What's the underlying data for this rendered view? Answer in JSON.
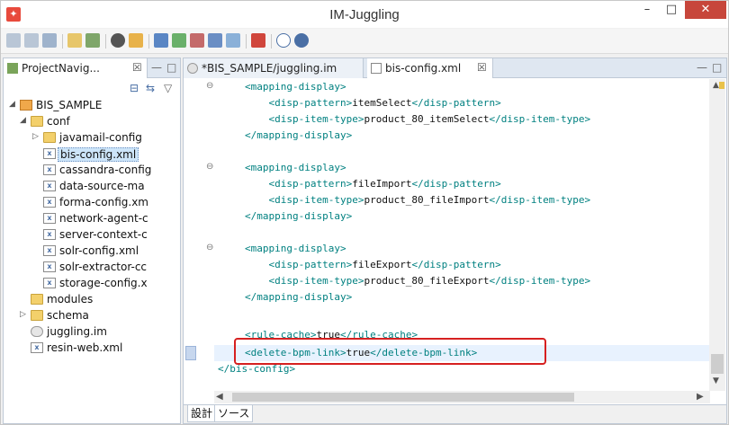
{
  "window": {
    "title": "IM-Juggling",
    "app_icon_glyph": "✦",
    "min_glyph": "–",
    "max_glyph": "□",
    "close_glyph": "✕"
  },
  "left_panel": {
    "tab_label": "ProjectNavig...",
    "tab_close": "☒",
    "ctl_min": "—",
    "ctl_max": "□",
    "collapse_glyph": "⊟",
    "link_glyph": "⇆",
    "menu_glyph": "▽",
    "tree": [
      {
        "label": "BIS_SAMPLE",
        "icon": "project-icon",
        "expanded": true
      },
      {
        "label": "conf",
        "icon": "folder-icon",
        "expanded": true
      },
      {
        "label": "javamail-config",
        "icon": "folder-icon",
        "expanded": false
      },
      {
        "label": "bis-config.xml",
        "icon": "xml-file-icon"
      },
      {
        "label": "cassandra-config",
        "icon": "xml-file-icon"
      },
      {
        "label": "data-source-ma",
        "icon": "xml-file-icon"
      },
      {
        "label": "forma-config.xm",
        "icon": "xml-file-icon"
      },
      {
        "label": "network-agent-c",
        "icon": "xml-file-icon"
      },
      {
        "label": "server-context-c",
        "icon": "xml-file-icon"
      },
      {
        "label": "solr-config.xml",
        "icon": "xml-file-icon"
      },
      {
        "label": "solr-extractor-cc",
        "icon": "xml-file-icon"
      },
      {
        "label": "storage-config.x",
        "icon": "xml-file-icon"
      },
      {
        "label": "modules",
        "icon": "folder-icon"
      },
      {
        "label": "schema",
        "icon": "folder-icon",
        "expanded": false
      },
      {
        "label": "juggling.im",
        "icon": "im-file-icon"
      },
      {
        "label": "resin-web.xml",
        "icon": "xml-file-icon"
      }
    ]
  },
  "editor": {
    "tabs": [
      {
        "label": "*BIS_SAMPLE/juggling.im"
      },
      {
        "label": "bis-config.xml",
        "close": "☒"
      }
    ],
    "ctl_min": "—",
    "ctl_max": "□",
    "fold_glyph": "⊖",
    "code_lines": [
      {
        "open": "<mapping-display>",
        "text": "",
        "close": ""
      },
      {
        "open": "    <disp-pattern>",
        "text": "itemSelect",
        "close": "</disp-pattern>"
      },
      {
        "open": "    <disp-item-type>",
        "text": "product_80_itemSelect",
        "close": "</disp-item-type>"
      },
      {
        "open": "</mapping-display>",
        "text": "",
        "close": ""
      },
      {
        "open": "",
        "text": "",
        "close": ""
      },
      {
        "open": "<mapping-display>",
        "text": "",
        "close": ""
      },
      {
        "open": "    <disp-pattern>",
        "text": "fileImport",
        "close": "</disp-pattern>"
      },
      {
        "open": "    <disp-item-type>",
        "text": "product_80_fileImport",
        "close": "</disp-item-type>"
      },
      {
        "open": "</mapping-display>",
        "text": "",
        "close": ""
      },
      {
        "open": "",
        "text": "",
        "close": ""
      },
      {
        "open": "<mapping-display>",
        "text": "",
        "close": ""
      },
      {
        "open": "    <disp-pattern>",
        "text": "fileExport",
        "close": "</disp-pattern>"
      },
      {
        "open": "    <disp-item-type>",
        "text": "product_80_fileExport",
        "close": "</disp-item-type>"
      },
      {
        "open": "</mapping-display>",
        "text": "",
        "close": ""
      },
      {
        "open": "",
        "text": "",
        "close": ""
      },
      {
        "open": "<rule-cache>",
        "text": "true",
        "close": "</rule-cache>"
      },
      {
        "open": "<delete-bpm-link>",
        "text": "true",
        "close": "</delete-bpm-link>"
      },
      {
        "open": "</bis-config>",
        "text": "",
        "close": ""
      }
    ],
    "bottom_tabs": [
      "設計",
      "ソース"
    ]
  },
  "colors": {
    "highlight_border": "#d62020",
    "xml_tag": "#008080",
    "selected_row": "#cde5f9"
  }
}
